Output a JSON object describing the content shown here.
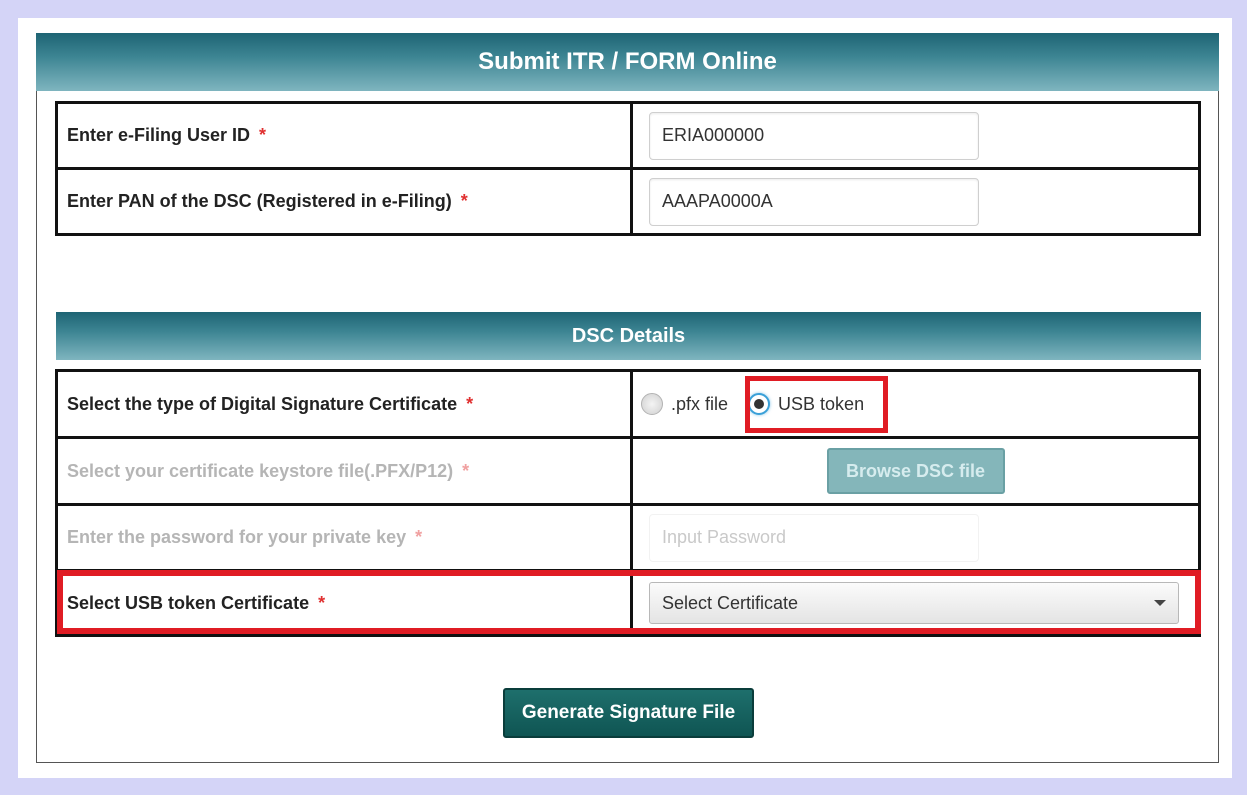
{
  "header": {
    "title": "Submit ITR / FORM Online"
  },
  "user_id": {
    "label": "Enter e-Filing User ID",
    "required": "*",
    "value": "ERIA000000"
  },
  "pan": {
    "label": "Enter PAN of the DSC (Registered in e-Filing)",
    "required": "*",
    "value": "AAAPA0000A"
  },
  "dsc_section": {
    "title": "DSC Details"
  },
  "dsc_type": {
    "label": "Select the type of Digital Signature Certificate",
    "required": "*",
    "options": [
      ".pfx file",
      "USB token"
    ],
    "selected": "USB token"
  },
  "keystore": {
    "label": "Select your certificate keystore file(.PFX/P12)",
    "required": "*",
    "button_label": "Browse DSC file"
  },
  "password": {
    "label": "Enter the password for your private key",
    "required": "*",
    "placeholder": "Input Password"
  },
  "usb_cert": {
    "label": "Select USB token Certificate",
    "required": "*",
    "selected": "Select Certificate"
  },
  "actions": {
    "generate_label": "Generate Signature File"
  },
  "colors": {
    "header": "#2f7786",
    "button": "#0f5553",
    "highlight": "#e01c24",
    "required": "#e03030"
  }
}
